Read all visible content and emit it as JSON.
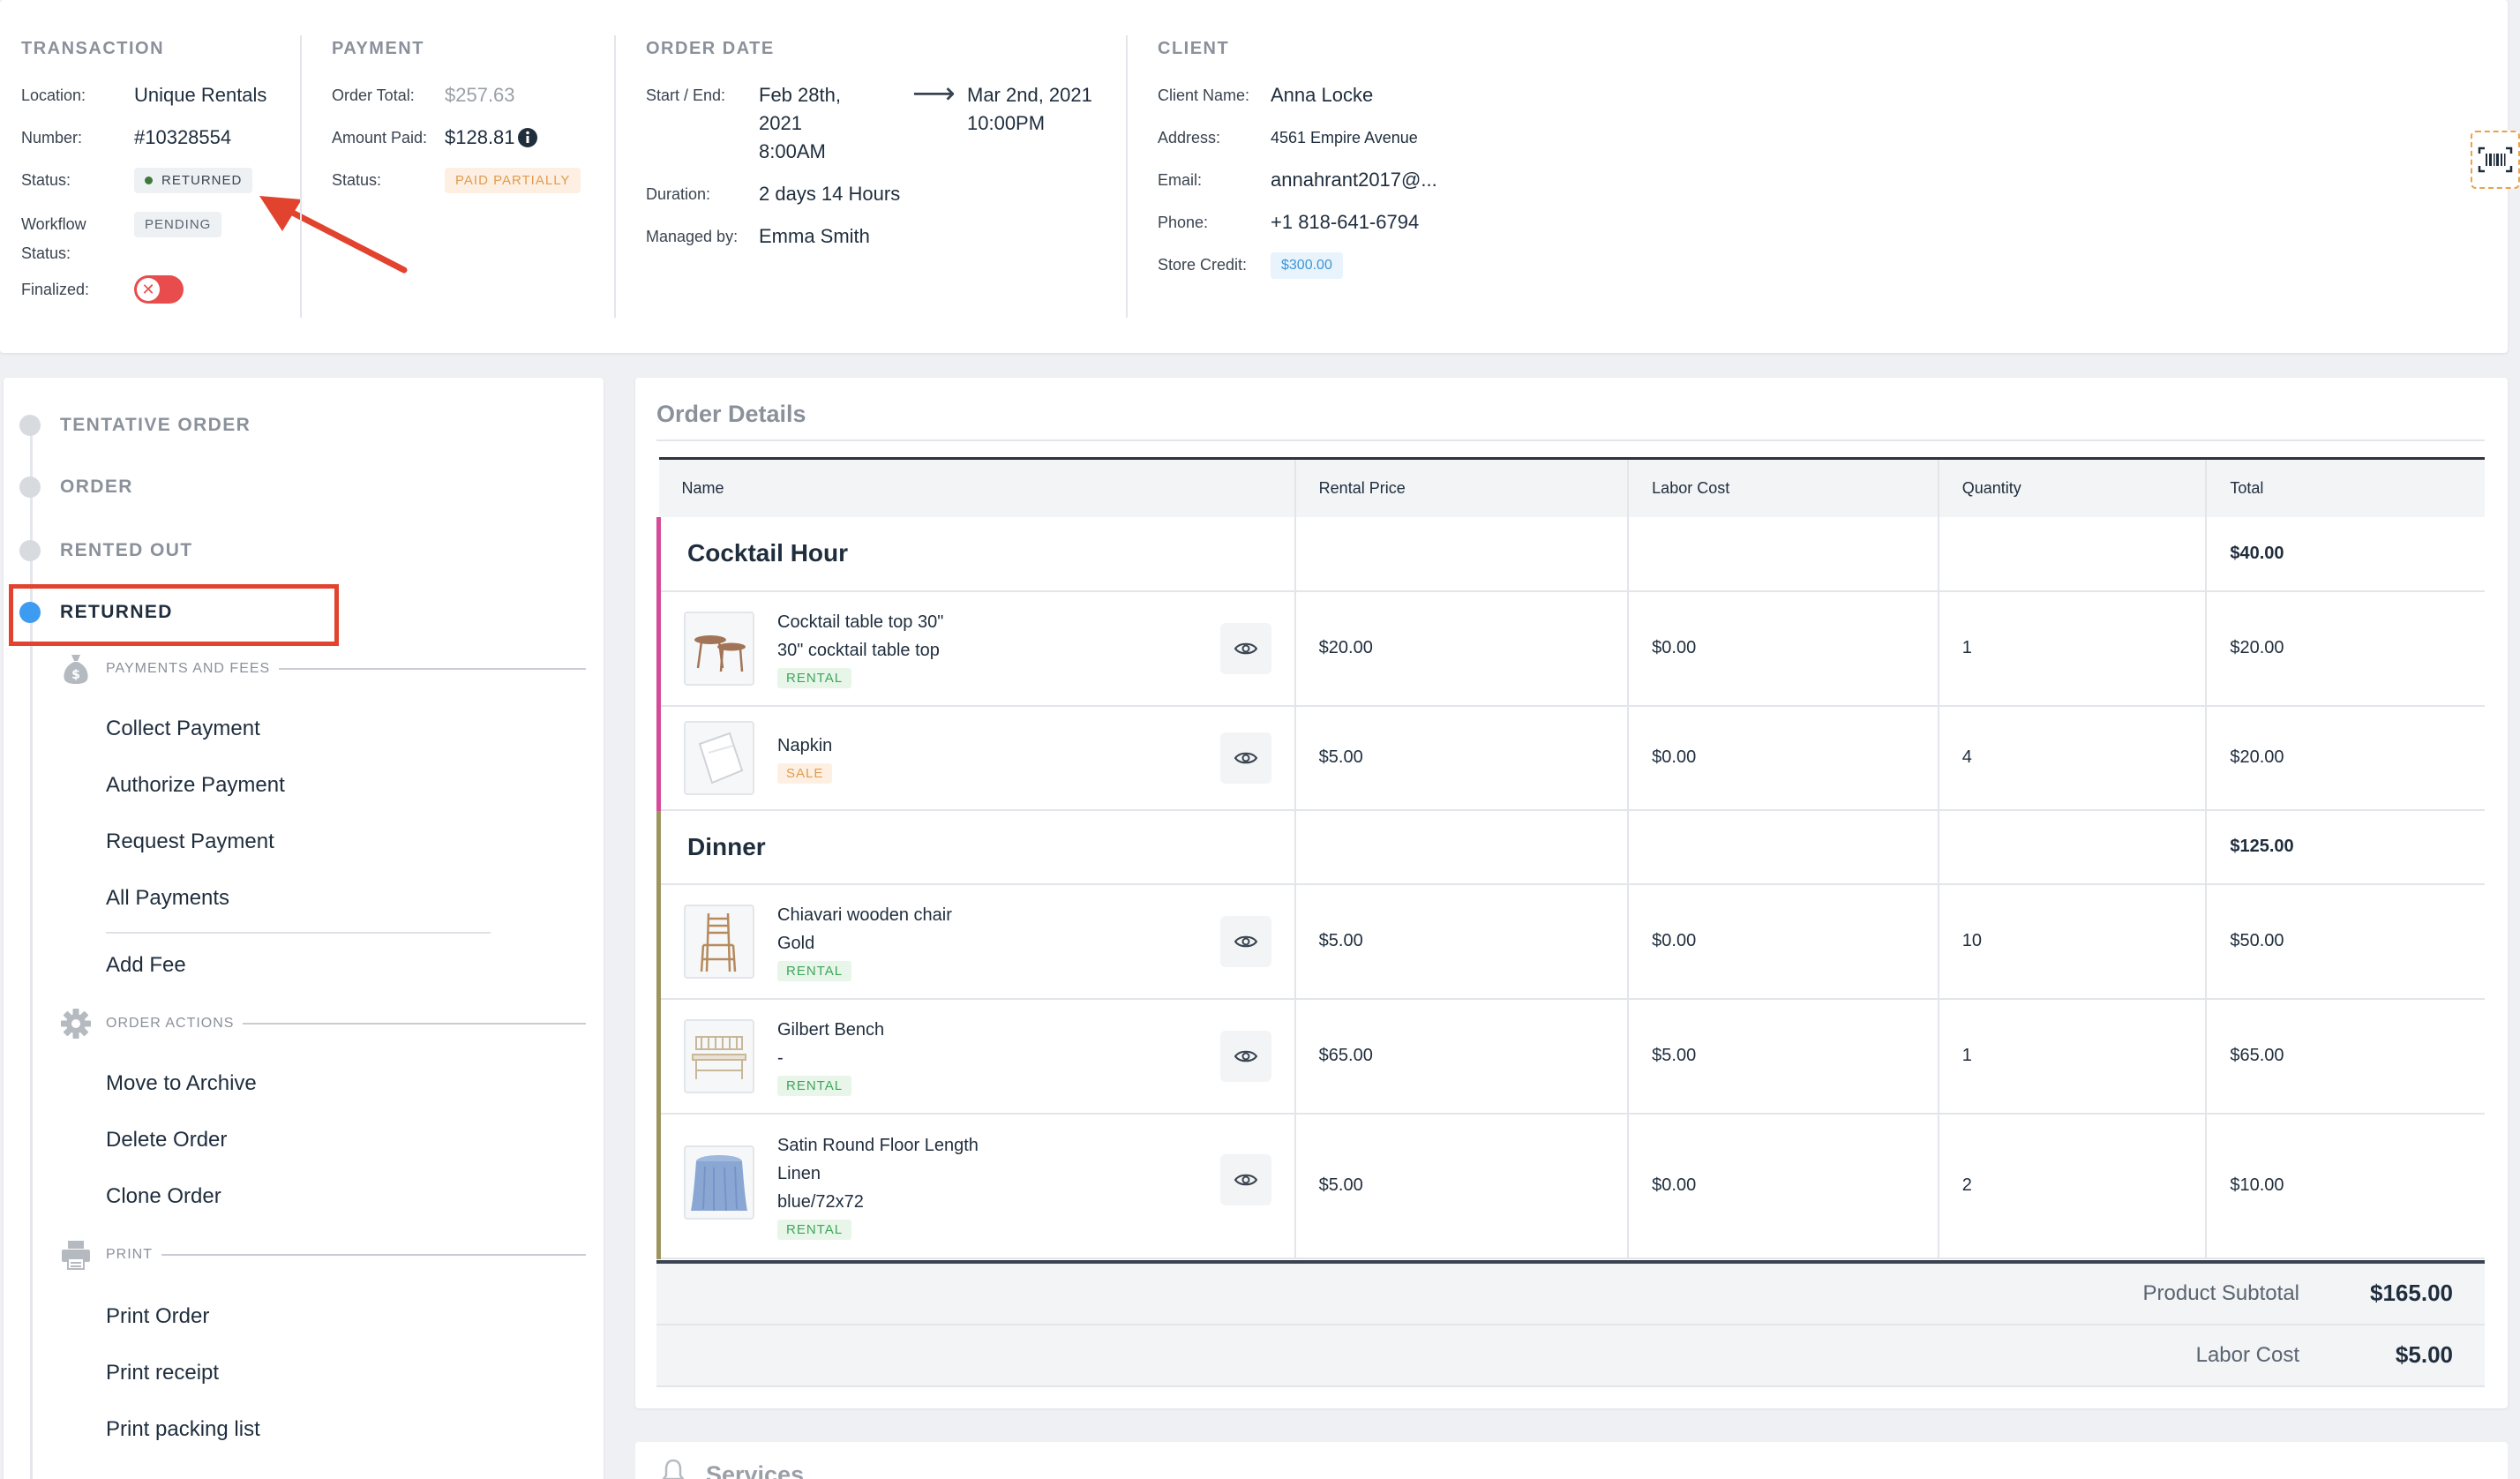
{
  "transaction": {
    "title": "TRANSACTION",
    "location_label": "Location:",
    "location_value": "Unique Rentals",
    "number_label": "Number:",
    "number_value": "#10328554",
    "status_label": "Status:",
    "status_value": "RETURNED",
    "workflow_label_1": "Workflow",
    "workflow_label_2": "Status:",
    "workflow_value": "PENDING",
    "finalized_label": "Finalized:"
  },
  "payment": {
    "title": "PAYMENT",
    "order_total_label": "Order Total:",
    "order_total_value": "$257.63",
    "amount_paid_label": "Amount Paid:",
    "amount_paid_value": "$128.81",
    "status_label": "Status:",
    "status_value": "PAID PARTIALLY"
  },
  "order_date": {
    "title": "ORDER DATE",
    "start_end_label": "Start / End:",
    "start_line1": "Feb 28th,",
    "start_line2": "2021",
    "start_line3": "8:00AM",
    "end_line1": "Mar 2nd, 2021",
    "end_line2": "10:00PM",
    "duration_label": "Duration:",
    "duration_value": "2 days 14 Hours",
    "managed_label": "Managed by:",
    "managed_value": "Emma Smith"
  },
  "client": {
    "title": "CLIENT",
    "name_label": "Client Name:",
    "name_value": "Anna Locke",
    "address_label": "Address:",
    "address_value": "4561 Empire Avenue",
    "email_label": "Email:",
    "email_value": "annahrant2017@...",
    "phone_label": "Phone:",
    "phone_value": "+1 818-641-6794",
    "credit_label": "Store Credit:",
    "credit_value": "$300.00"
  },
  "sidebar": {
    "steps": [
      {
        "label": "TENTATIVE ORDER"
      },
      {
        "label": "ORDER"
      },
      {
        "label": "RENTED OUT"
      },
      {
        "label": "RETURNED"
      }
    ],
    "payments_section": "PAYMENTS AND FEES",
    "payments_actions": [
      "Collect Payment",
      "Authorize Payment",
      "Request Payment",
      "All Payments",
      "Add Fee"
    ],
    "order_section": "ORDER ACTIONS",
    "order_actions": [
      "Move to Archive",
      "Delete Order",
      "Clone Order"
    ],
    "print_section": "PRINT",
    "print_actions": [
      "Print Order",
      "Print receipt",
      "Print packing list"
    ]
  },
  "order_details": {
    "title": "Order Details",
    "columns": [
      "Name",
      "Rental Price",
      "Labor Cost",
      "Quantity",
      "Total"
    ],
    "groups": [
      {
        "name": "Cocktail Hour",
        "total": "$40.00"
      },
      {
        "name": "Dinner",
        "total": "$125.00"
      }
    ],
    "items": [
      {
        "line1": "Cocktail table top 30\"",
        "line2": "30\" cocktail table top",
        "tag": "RENTAL",
        "price": "$20.00",
        "labor": "$0.00",
        "qty": "1",
        "total": "$20.00"
      },
      {
        "line1": "Napkin",
        "tag": "SALE",
        "price": "$5.00",
        "labor": "$0.00",
        "qty": "4",
        "total": "$20.00"
      },
      {
        "line1": "Chiavari wooden chair",
        "line2": "Gold",
        "tag": "RENTAL",
        "price": "$5.00",
        "labor": "$0.00",
        "qty": "10",
        "total": "$50.00"
      },
      {
        "line1": "Gilbert Bench",
        "line2": "-",
        "tag": "RENTAL",
        "price": "$65.00",
        "labor": "$5.00",
        "qty": "1",
        "total": "$65.00"
      },
      {
        "line1": "Satin Round Floor Length",
        "line2": "Linen",
        "line3": "blue/72x72",
        "tag": "RENTAL",
        "price": "$5.00",
        "labor": "$0.00",
        "qty": "2",
        "total": "$10.00"
      }
    ],
    "product_subtotal_label": "Product Subtotal",
    "product_subtotal_value": "$165.00",
    "labor_cost_label": "Labor Cost",
    "labor_cost_value": "$5.00"
  },
  "services": {
    "title": "Services"
  },
  "colors": {
    "accent": "#3d9bf2",
    "pink": "#d64a9a",
    "olive": "#9d9560",
    "annotation": "#e2432f"
  }
}
